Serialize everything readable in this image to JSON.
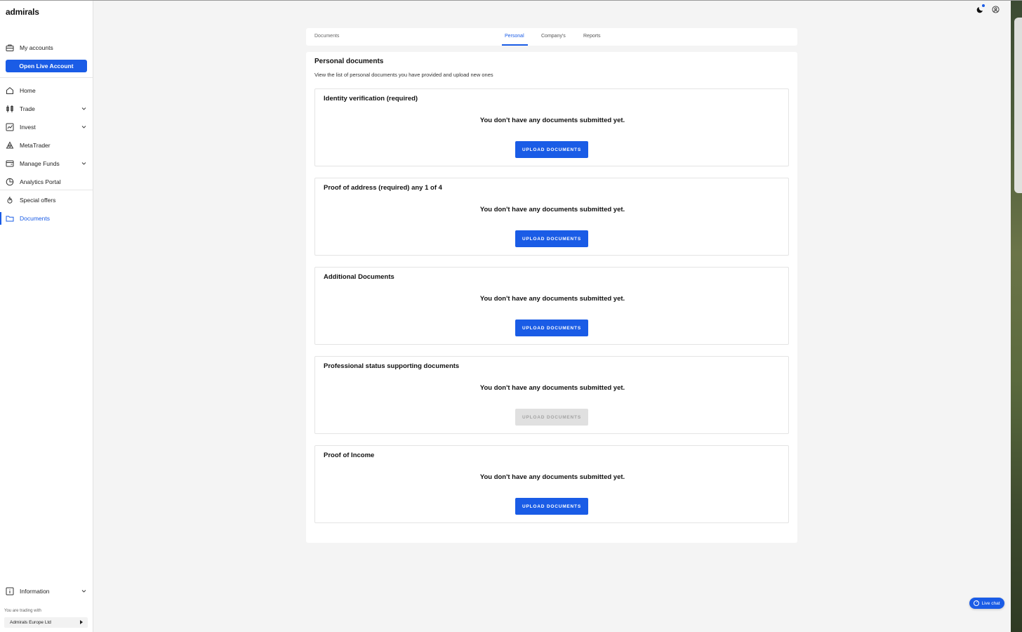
{
  "brand": {
    "logo_text": "admirals",
    "accent_color": "#1a5ce6"
  },
  "sidebar": {
    "my_accounts": "My accounts",
    "open_live_account": "Open Live Account",
    "items": [
      {
        "label": "Home",
        "icon": "home-icon"
      },
      {
        "label": "Trade",
        "icon": "candlestick-icon",
        "expandable": true
      },
      {
        "label": "Invest",
        "icon": "trend-chart-icon",
        "expandable": true
      },
      {
        "label": "MetaTrader",
        "icon": "metatrader-icon"
      },
      {
        "label": "Manage Funds",
        "icon": "wallet-icon",
        "expandable": true
      },
      {
        "label": "Analytics Portal",
        "icon": "pie-chart-icon"
      },
      {
        "label": "Special offers",
        "icon": "flame-icon"
      },
      {
        "label": "Documents",
        "icon": "folder-icon",
        "active": true
      }
    ],
    "information": "Information",
    "trading_with_label": "You are trading with",
    "entity": "Admirals Europe Ltd"
  },
  "tabs": {
    "breadcrumb": "Documents",
    "items": [
      "Personal",
      "Company's",
      "Reports"
    ],
    "active": "Personal"
  },
  "panel": {
    "title": "Personal documents",
    "subtitle": "View the list of personal documents you have provided and upload new ones",
    "cards": [
      {
        "title": "Identity verification (required)",
        "message": "You don't have any documents submitted yet.",
        "button": "UPLOAD DOCUMENTS",
        "disabled": false
      },
      {
        "title": "Proof of address (required) any 1 of 4",
        "message": "You don't have any documents submitted yet.",
        "button": "UPLOAD DOCUMENTS",
        "disabled": false
      },
      {
        "title": "Additional Documents",
        "message": "You don't have any documents submitted yet.",
        "button": "UPLOAD DOCUMENTS",
        "disabled": false
      },
      {
        "title": "Professional status supporting documents",
        "message": "You don't have any documents submitted yet.",
        "button": "UPLOAD DOCUMENTS",
        "disabled": true
      },
      {
        "title": "Proof of Income",
        "message": "You don't have any documents submitted yet.",
        "button": "UPLOAD DOCUMENTS",
        "disabled": false
      }
    ]
  },
  "live_chat": {
    "label": "Live chat"
  }
}
